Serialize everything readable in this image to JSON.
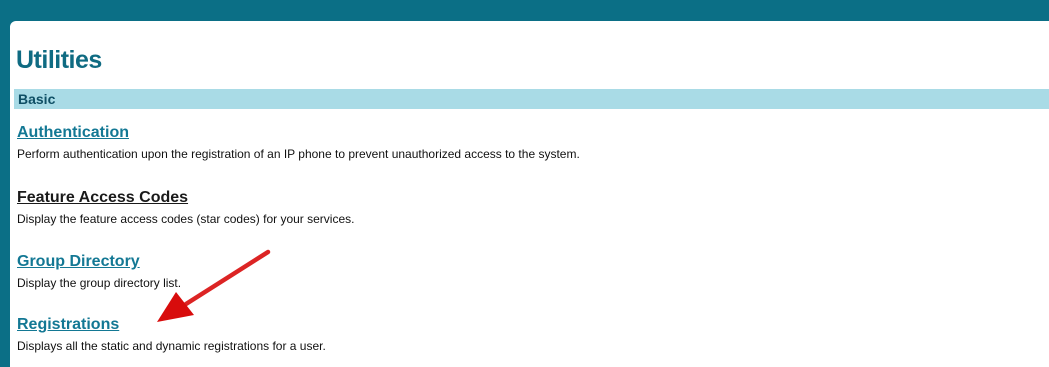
{
  "page": {
    "title": "Utilities",
    "section": "Basic"
  },
  "items": [
    {
      "label": "Authentication",
      "description": "Perform authentication upon the registration of an IP phone to prevent unauthorized access to the system."
    },
    {
      "label": "Feature Access Codes",
      "description": "Display the feature access codes (star codes) for your services."
    },
    {
      "label": "Group Directory",
      "description": "Display the group directory list."
    },
    {
      "label": "Registrations",
      "description": "Displays all the static and dynamic registrations for a user."
    }
  ],
  "colors": {
    "frame": "#0b6f86",
    "title": "#0f6b82",
    "section_bar": "#a9dbe6",
    "link": "#137894",
    "annotation_arrow": "#e01010"
  },
  "annotation": {
    "icon": "red-arrow-icon",
    "points_to": "Registrations"
  }
}
